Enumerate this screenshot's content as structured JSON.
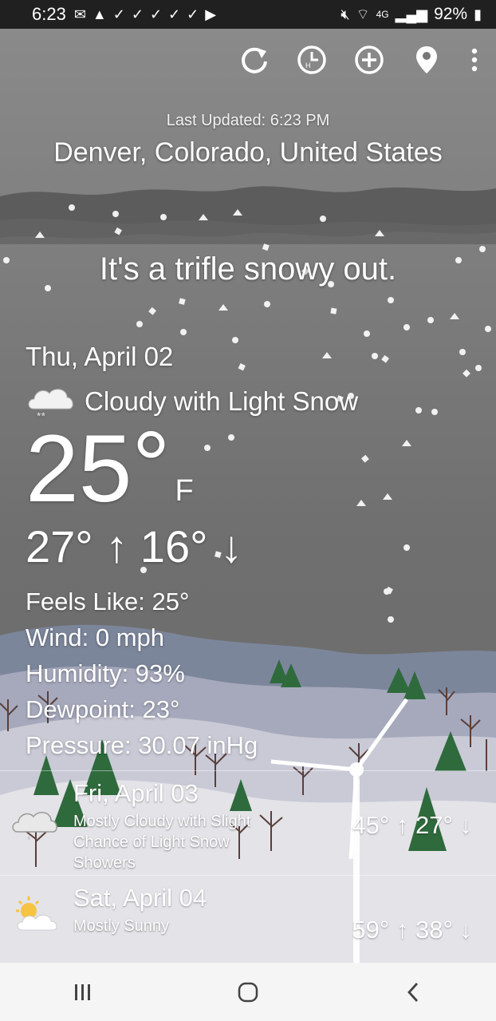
{
  "status_bar": {
    "time": "6:23",
    "network": "4G",
    "battery": "92%",
    "notification_icons": [
      "gmail-icon",
      "alert-icon",
      "check-icon",
      "check-icon",
      "check-icon",
      "check-icon",
      "check-icon",
      "youtube-icon"
    ],
    "status_icons": [
      "mute-icon",
      "wifi-calling-icon",
      "signal-icon",
      "battery-icon"
    ]
  },
  "toolbar": {
    "actions": [
      "refresh-icon",
      "hourly-icon",
      "add-icon",
      "location-pin-icon",
      "more-icon"
    ]
  },
  "header": {
    "last_updated": "Last Updated: 6:23 PM",
    "location": "Denver, Colorado, United States",
    "tagline": "It's a trifle snowy out."
  },
  "current": {
    "date": "Thu, April 02",
    "condition": "Cloudy with Light Snow",
    "condition_icon": "cloud-snow-icon",
    "temperature": "25",
    "degree_symbol": "°",
    "unit": "F",
    "hi_lo": "27° ↑ 16° ↓",
    "feels_like": "Feels Like: 25°",
    "wind": "Wind: 0 mph",
    "humidity": "Humidity: 93%",
    "dewpoint": "Dewpoint: 23°",
    "pressure": "Pressure: 30.07 inHg"
  },
  "forecast": [
    {
      "day": "Fri, April 03",
      "description": "Mostly Cloudy with Slight Chance of Light Snow Showers",
      "hi_lo": "45° ↑ 27° ↓",
      "icon": "cloud-snow-icon"
    },
    {
      "day": "Sat, April 04",
      "description": "Mostly Sunny",
      "hi_lo": "59° ↑ 38° ↓",
      "icon": "sun-cloud-icon"
    }
  ],
  "nav_bar": {
    "buttons": [
      "recents-button",
      "home-button",
      "back-button"
    ]
  },
  "colors": {
    "sky": "#7a7a7a",
    "cloud_band": "#5e5e5e",
    "mountains": "#7d879c",
    "snow_ground": "#e6e6ea",
    "tree_green": "#2f6a3c"
  }
}
